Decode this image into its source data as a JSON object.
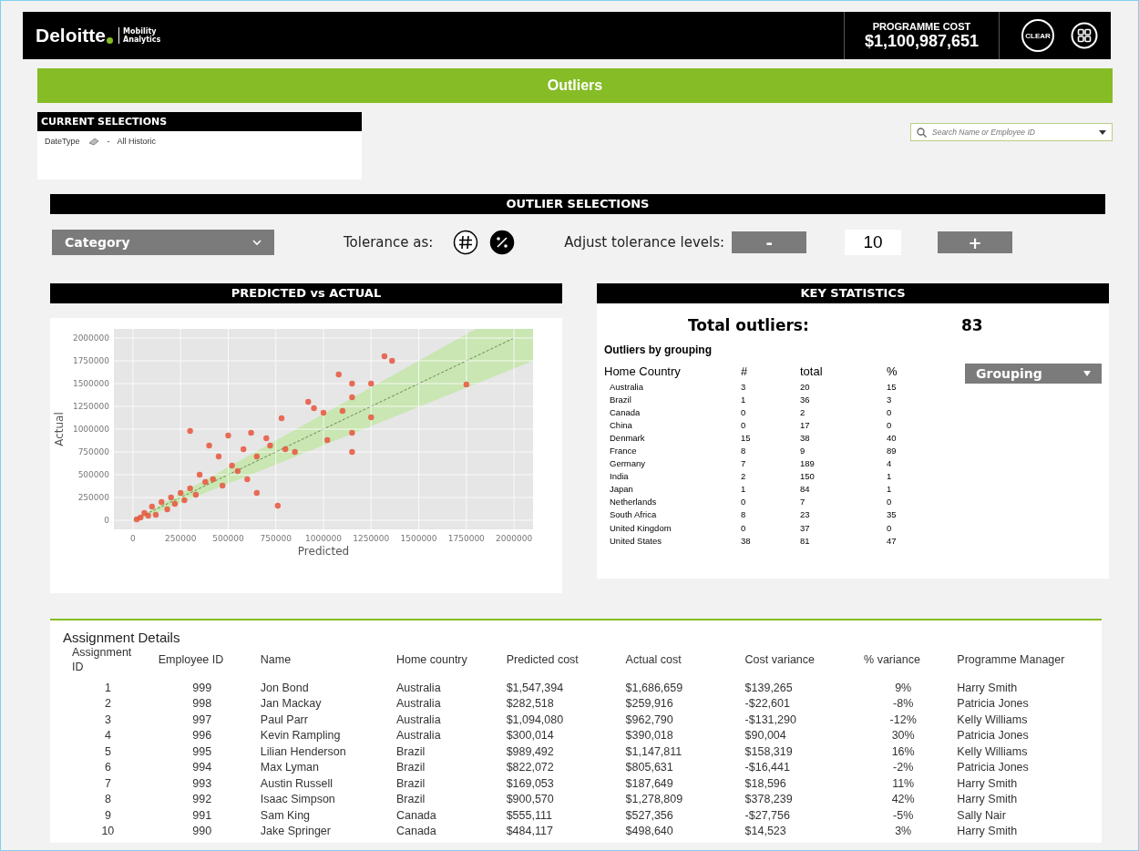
{
  "header": {
    "brand": "Deloitte",
    "product_line1": "Mobility",
    "product_line2": "Analytics",
    "cost_label": "PROGRAMME COST",
    "cost_value": "$1,100,987,651",
    "clear_label": "CLEAR"
  },
  "page_title": "Outliers",
  "current_selections": {
    "title": "CURRENT SELECTIONS",
    "field": "DateType",
    "separator": "-",
    "value": "All Historic"
  },
  "search": {
    "placeholder": "Search Name or Employee ID"
  },
  "outlier_selections": {
    "title": "OUTLIER SELECTIONS",
    "category": "Category",
    "tolerance_label": "Tolerance as:",
    "tolerance_modes": [
      {
        "kind": "number",
        "selected": false
      },
      {
        "kind": "percent",
        "selected": true
      }
    ],
    "adjust_label": "Adjust tolerance levels:",
    "minus": "-",
    "value": "10",
    "plus": "+"
  },
  "predicted_vs_actual": {
    "title": "PREDICTED vs ACTUAL",
    "chart_data": {
      "type": "scatter",
      "xlabel": "Predicted",
      "ylabel": "Actual",
      "xlim": [
        -100000,
        2100000
      ],
      "ylim": [
        -100000,
        2100000
      ],
      "xticks": [
        0,
        250000,
        500000,
        750000,
        1000000,
        1250000,
        1500000,
        1750000,
        2000000
      ],
      "yticks": [
        0,
        250000,
        500000,
        750000,
        1000000,
        1250000,
        1500000,
        1750000,
        2000000
      ],
      "x": [
        20000,
        40000,
        60000,
        80000,
        100000,
        120000,
        150000,
        180000,
        200000,
        220000,
        250000,
        270000,
        300000,
        300000,
        330000,
        350000,
        380000,
        400000,
        420000,
        450000,
        470000,
        500000,
        520000,
        550000,
        580000,
        600000,
        620000,
        650000,
        650000,
        700000,
        720000,
        760000,
        780000,
        800000,
        850000,
        920000,
        950000,
        1000000,
        1020000,
        1080000,
        1100000,
        1150000,
        1150000,
        1150000,
        1150000,
        1250000,
        1250000,
        1320000,
        1360000,
        1750000
      ],
      "grid": true,
      "series": [
        {
          "color": "#e8533c",
          "values": [
            10000,
            30000,
            80000,
            50000,
            150000,
            60000,
            200000,
            120000,
            250000,
            180000,
            300000,
            220000,
            980000,
            350000,
            280000,
            500000,
            420000,
            820000,
            450000,
            700000,
            380000,
            930000,
            600000,
            540000,
            780000,
            450000,
            960000,
            300000,
            700000,
            900000,
            820000,
            160000,
            1120000,
            780000,
            750000,
            1300000,
            1230000,
            1180000,
            880000,
            1600000,
            1200000,
            1500000,
            1350000,
            750000,
            960000,
            1500000,
            1130000,
            1800000,
            1750000,
            1490000
          ]
        }
      ]
    }
  },
  "key_statistics": {
    "title": "KEY STATISTICS",
    "total_label": "Total outliers:",
    "total_value": "83",
    "grouping_title": "Outliers by grouping",
    "grouping_button": "Grouping",
    "columns": [
      "Home Country",
      "#",
      "total",
      "%"
    ],
    "rows": [
      [
        "Australia",
        "3",
        "20",
        "15"
      ],
      [
        "Brazil",
        "1",
        "36",
        "3"
      ],
      [
        "Canada",
        "0",
        "2",
        "0"
      ],
      [
        "China",
        "0",
        "17",
        "0"
      ],
      [
        "Denmark",
        "15",
        "38",
        "40"
      ],
      [
        "France",
        "8",
        "9",
        "89"
      ],
      [
        "Germany",
        "7",
        "189",
        "4"
      ],
      [
        "India",
        "2",
        "150",
        "1"
      ],
      [
        "Japan",
        "1",
        "84",
        "1"
      ],
      [
        "Netherlands",
        "0",
        "7",
        "0"
      ],
      [
        "South Africa",
        "8",
        "23",
        "35"
      ],
      [
        "United Kingdom",
        "0",
        "37",
        "0"
      ],
      [
        "United States",
        "38",
        "81",
        "47"
      ]
    ]
  },
  "assignment_details": {
    "title": "Assignment Details",
    "columns": [
      "Assignment ID",
      "Employee ID",
      "Name",
      "Home country",
      "Predicted cost",
      "Actual cost",
      "Cost variance",
      "% variance",
      "Programme Manager"
    ],
    "rows": [
      [
        "1",
        "999",
        "Jon Bond",
        "Australia",
        "$1,547,394",
        "$1,686,659",
        "$139,265",
        "9%",
        "Harry Smith"
      ],
      [
        "2",
        "998",
        "Jan Mackay",
        "Australia",
        "$282,518",
        "$259,916",
        "-$22,601",
        "-8%",
        "Patricia Jones"
      ],
      [
        "3",
        "997",
        "Paul Parr",
        "Australia",
        "$1,094,080",
        "$962,790",
        "-$131,290",
        "-12%",
        "Kelly Williams"
      ],
      [
        "4",
        "996",
        "Kevin Rampling",
        "Australia",
        "$300,014",
        "$390,018",
        "$90,004",
        "30%",
        "Patricia Jones"
      ],
      [
        "5",
        "995",
        "Lilian Henderson",
        "Brazil",
        "$989,492",
        "$1,147,811",
        "$158,319",
        "16%",
        "Kelly Williams"
      ],
      [
        "6",
        "994",
        "Max Lyman",
        "Brazil",
        "$822,072",
        "$805,631",
        "-$16,441",
        "-2%",
        "Patricia Jones"
      ],
      [
        "7",
        "993",
        "Austin Russell",
        "Brazil",
        "$169,053",
        "$187,649",
        "$18,596",
        "11%",
        "Harry Smith"
      ],
      [
        "8",
        "992",
        "Isaac Simpson",
        "Brazil",
        "$900,570",
        "$1,278,809",
        "$378,239",
        "42%",
        "Harry Smith"
      ],
      [
        "9",
        "991",
        "Sam King",
        "Canada",
        "$555,111",
        "$527,356",
        "-$27,756",
        "-5%",
        "Sally Nair"
      ],
      [
        "10",
        "990",
        "Jake Springer",
        "Canada",
        "$484,117",
        "$498,640",
        "$14,523",
        "3%",
        "Harry Smith"
      ]
    ]
  }
}
